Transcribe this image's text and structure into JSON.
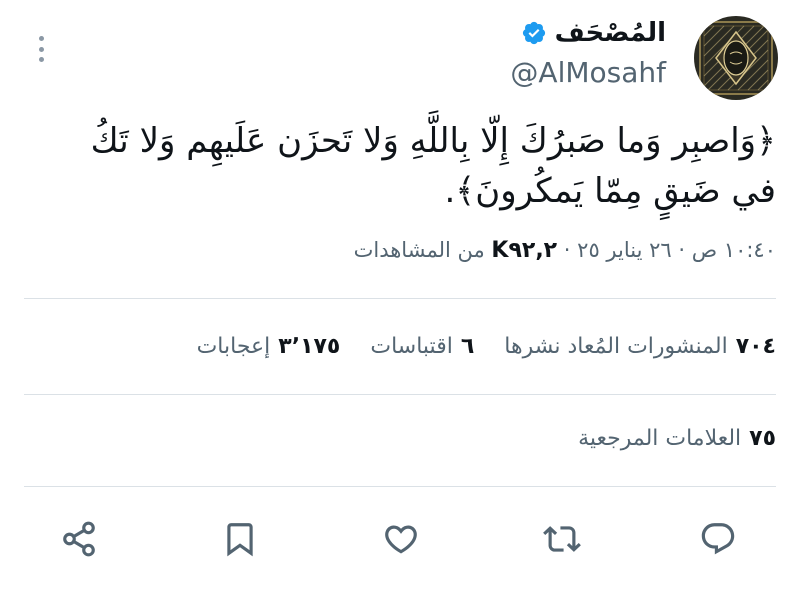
{
  "author": {
    "name": "المُصْحَف",
    "handle": "@AlMosahf",
    "verified_color": "#1d9bf0"
  },
  "tweet": {
    "text": "﴿وَاصبِر وَما صَبرُكَ إِلّا بِاللَّهِ وَلا تَحزَن عَلَيهِم وَلا تَكُ في ضَيقٍ مِمّا يَمكُرونَ﴾.",
    "time": "١٠:٤٠ ص",
    "date": "٢٦ يناير ٢٥",
    "views_count": "K٩٢,٢",
    "views_label": "من المشاهدات"
  },
  "stats": {
    "reposts_count": "٧٠٤",
    "reposts_label": "المنشورات المُعاد نشرها",
    "quotes_count": "٦",
    "quotes_label": "اقتباسات",
    "likes_count": "٣٬١٧٥",
    "likes_label": "إعجابات",
    "bookmarks_count": "٧٥",
    "bookmarks_label": "العلامات المرجعية"
  },
  "icons": {
    "more": "more-vertical-icon",
    "reply": "reply-icon",
    "retweet": "retweet-icon",
    "like": "heart-icon",
    "bookmark": "bookmark-icon",
    "share": "share-icon"
  },
  "colors": {
    "text_primary": "#0f1419",
    "text_secondary": "#536471",
    "divider": "#dbe1e6",
    "icon": "#536471"
  }
}
